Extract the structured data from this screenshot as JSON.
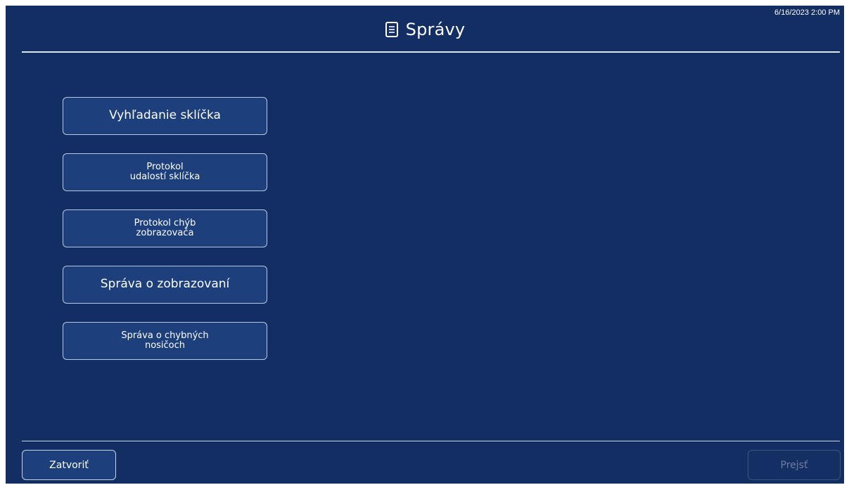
{
  "header": {
    "title": "Správy",
    "title_icon": "document-list-icon",
    "timestamp": "6/16/2023 2:00 PM"
  },
  "menu": {
    "items": [
      {
        "label": "Vyhľadanie sklíčka"
      },
      {
        "label": "Protokol\nudalostí sklíčka"
      },
      {
        "label": "Protokol chýb\nzobrazovača"
      },
      {
        "label": "Správa o zobrazovaní"
      },
      {
        "label": "Správa o chybných\nnosičoch"
      }
    ]
  },
  "footer": {
    "close_label": "Zatvoriť",
    "go_label": "Prejsť",
    "go_enabled": false
  },
  "colors": {
    "background": "#122e63",
    "button": "#1d3f7c",
    "border": "#b9c6df",
    "disabled_text": "#6f7ea0"
  }
}
